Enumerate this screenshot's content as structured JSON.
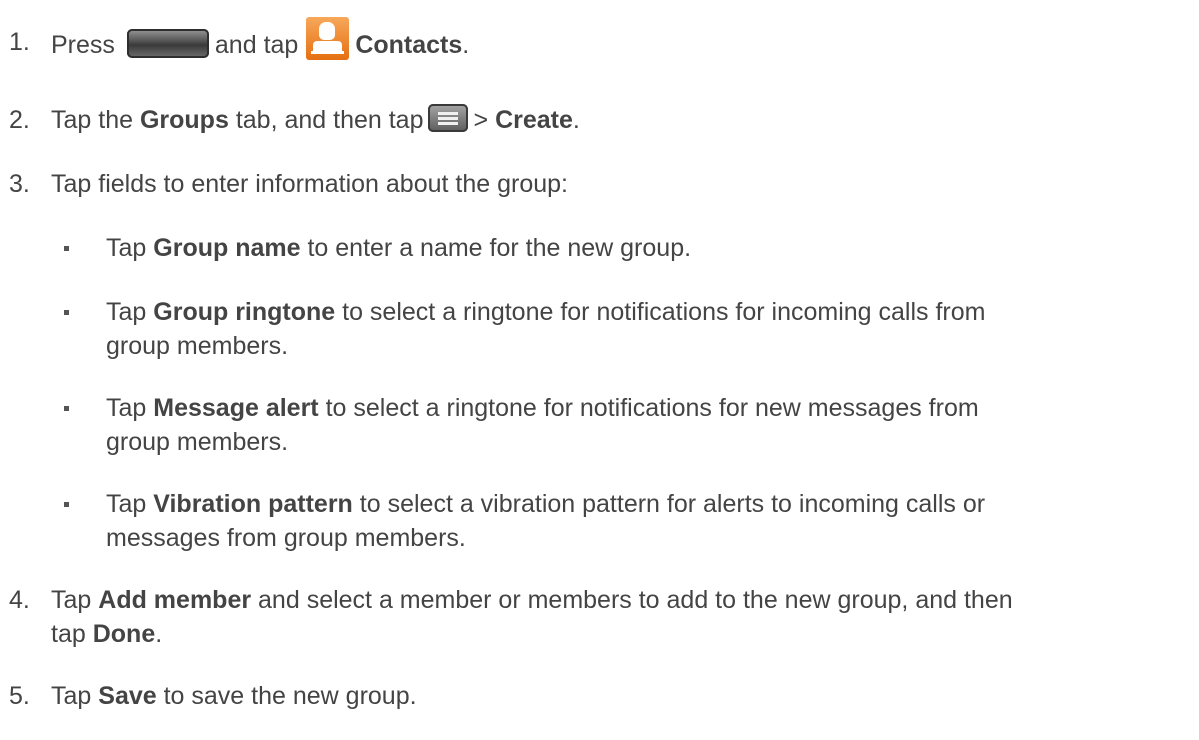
{
  "steps": [
    {
      "number": "1.",
      "text": [
        "Press",
        "and tap",
        "Contacts",
        "."
      ],
      "icons": [
        "home-key-icon",
        "contacts-app-icon"
      ]
    },
    {
      "number": "2.",
      "text": [
        "Tap the",
        "Groups",
        "tab, and then tap",
        ">",
        "Create",
        "."
      ],
      "icons": [
        "menu-key-icon"
      ]
    },
    {
      "number": "3.",
      "text": "Tap fields to enter information about the group:",
      "bullets": [
        {
          "lead": "Tap",
          "bold": "Group name",
          "rest": "to enter a name for the new group."
        },
        {
          "lead": "Tap",
          "bold": "Group ringtone",
          "rest": "to select a ringtone for notifications for incoming calls from",
          "rest2": "group members."
        },
        {
          "lead": "Tap",
          "bold": "Message alert",
          "rest": "to select a ringtone for notifications for new messages from",
          "rest2": "group members."
        },
        {
          "lead": "Tap",
          "bold": "Vibration pattern",
          "rest": "to select a vibration pattern for alerts to incoming calls or",
          "rest2": "messages from group members."
        }
      ]
    },
    {
      "number": "4.",
      "text": [
        "Tap",
        "Add member",
        "and select a member or members to add to the new group, and then",
        "tap",
        "Done",
        "."
      ]
    },
    {
      "number": "5.",
      "text": [
        "Tap",
        "Save",
        "to save the new group."
      ]
    }
  ]
}
